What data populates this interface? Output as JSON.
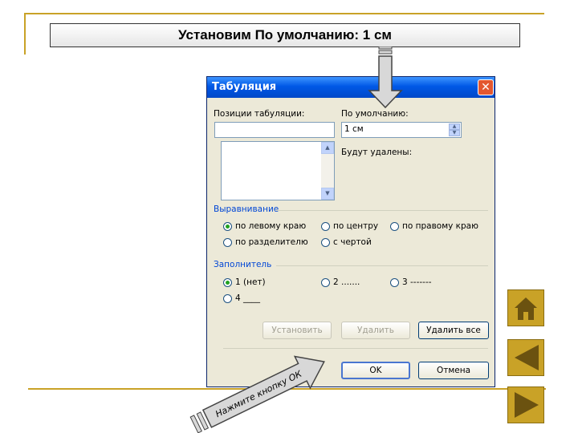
{
  "slide": {
    "title": "Установим По умолчанию: 1 см",
    "hint": "Нажмите кнопку ОК"
  },
  "dialog": {
    "title": "Табуляция",
    "close_glyph": "✕",
    "tab_positions_label": "Позиции табуляции:",
    "tab_positions_value": "",
    "default_label": "По умолчанию:",
    "default_value": "1 см",
    "to_remove_label": "Будут удалены:",
    "alignment": {
      "title": "Выравнивание",
      "options": [
        {
          "label": "по левому краю",
          "checked": true
        },
        {
          "label": "по центру",
          "checked": false
        },
        {
          "label": "по правому краю",
          "checked": false
        },
        {
          "label": "по разделителю",
          "checked": false
        },
        {
          "label": "с чертой",
          "checked": false
        }
      ]
    },
    "filler": {
      "title": "Заполнитель",
      "options": [
        {
          "label": "1 (нет)",
          "checked": true
        },
        {
          "label": "2 .......",
          "checked": false
        },
        {
          "label": "3 -------",
          "checked": false
        },
        {
          "label": "4 ____",
          "checked": false
        }
      ]
    },
    "buttons": {
      "set": "Установить",
      "delete": "Удалить",
      "delete_all": "Удалить все",
      "ok": "OK",
      "cancel": "Отмена"
    }
  },
  "nav": {
    "home": "home-icon",
    "back": "triangle-left-icon",
    "forward": "triangle-right-icon"
  },
  "colors": {
    "accent": "#c9a227",
    "titlebar": "#0058e6",
    "arrow_fill": "#d8d8d8"
  }
}
